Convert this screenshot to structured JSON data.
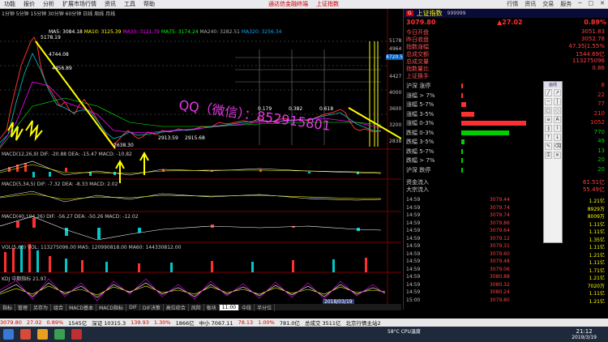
{
  "menubar": {
    "items": [
      "功能",
      "报价",
      "分析",
      "扩展市场行情",
      "资讯",
      "工具",
      "帮助"
    ],
    "center_links": [
      "通达信金融终端",
      "上证指数"
    ],
    "window_buttons": [
      "行情",
      "资讯",
      "交易",
      "服务"
    ]
  },
  "chart": {
    "period_tabs": [
      "1分钟",
      "5分钟",
      "15分钟",
      "30分钟",
      "60分钟",
      "日线",
      "周线",
      "月线"
    ],
    "ma_legend": [
      {
        "label": "MA5: 3084.18",
        "color": "#ffffff"
      },
      {
        "label": "MA10: 3125.39",
        "color": "#ffff00"
      },
      {
        "label": "MA30: 3121.79",
        "color": "#ff00ff"
      },
      {
        "label": "MA75: 3174.24",
        "color": "#00ff00"
      },
      {
        "label": "MA240: 3282.51",
        "color": "#888888"
      },
      {
        "label": "MA320: 3256.34",
        "color": "#00aaff"
      }
    ],
    "price_labels": [
      "5178",
      "4964",
      "4720.5",
      "4427",
      "4000",
      "3600",
      "3200",
      "2838"
    ],
    "left_annotations": [
      "5178.19",
      "4744.08",
      "4456.89",
      "2638.30",
      "2913.59",
      "2915.68"
    ],
    "fib_labels": [
      "0.179",
      "0.382",
      "0.618"
    ],
    "watermark": "QQ（微信）：852915801",
    "sub_panels": [
      {
        "label": "MACD(12,26,9)  DIF: -20.88  DEA: -15.47  MACD: -10.82"
      },
      {
        "label": "MACD(5,34,5)  DIF: -7.32  DEA: -8.33  MACD: 2.02"
      },
      {
        "label": "MACD(40,104,26)  DIF: -56.27  DEA: -50.26  MACD: -12.02"
      },
      {
        "label": "VOL(5,60)  VOL: 113275096.00  MA5: 120990818.00  MA60: 144330812.00"
      },
      {
        "label": "KDJ  中期指标  21.97"
      }
    ],
    "date_marker": "2018/03/19",
    "time_label": "11:00"
  },
  "tabs": [
    "指标",
    "管理",
    "另存为",
    "组合",
    "MACD基本",
    "MACD指标",
    "DIF",
    "DIF决策",
    "高位综合",
    "风险",
    "板块",
    "11:00",
    "中段",
    "半分位"
  ],
  "index_panel": {
    "badge": "G",
    "name": "上证指数",
    "code": "999999",
    "price": "3079.80",
    "change": "▲27.02",
    "pct": "0.89%",
    "rows": [
      {
        "label": "今日开盘",
        "value": "3051.83"
      },
      {
        "label": "昨日收盘",
        "value": "3052.78"
      },
      {
        "label": "指数涨幅",
        "value": "47.35|1.55%"
      },
      {
        "label": "总成交额",
        "value": "1544.69亿"
      },
      {
        "label": "总成交量",
        "value": "113275096"
      },
      {
        "label": "指数量比",
        "value": "0.86"
      },
      {
        "label": "上证换手",
        "value": ""
      }
    ],
    "breadth": [
      {
        "label": "沪深 涨停",
        "value": "8",
        "color": "#ff3030"
      },
      {
        "label": "涨幅 > 7%",
        "value": "22",
        "color": "#ff3030"
      },
      {
        "label": "涨幅 5-7%",
        "value": "77",
        "color": "#ff3030"
      },
      {
        "label": "涨幅 3-5%",
        "value": "210",
        "color": "#ff3030"
      },
      {
        "label": "涨幅 0-3%",
        "value": "1052",
        "color": "#ff3030"
      },
      {
        "label": "跌幅 0-3%",
        "value": "770",
        "color": "#00d000"
      },
      {
        "label": "跌幅 3-5%",
        "value": "49",
        "color": "#00d000"
      },
      {
        "label": "跌幅 5-7%",
        "value": "13",
        "color": "#00d000"
      },
      {
        "label": "跌幅 > 7%",
        "value": "20",
        "color": "#00d000"
      },
      {
        "label": "沪深 跌停",
        "value": "20",
        "color": "#00d000"
      }
    ],
    "money_in": "61.51亿",
    "money_out": "55.49亿",
    "big_in_label": "大宗流入",
    "ticks": [
      {
        "time": "14:59",
        "price": "3079.44",
        "vol": "1.21亿"
      },
      {
        "time": "14:59",
        "price": "3079.74",
        "vol": "8929万"
      },
      {
        "time": "14:59",
        "price": "3079.74",
        "vol": "8009万"
      },
      {
        "time": "14:59",
        "price": "3079.86",
        "vol": "1.11亿"
      },
      {
        "time": "14:59",
        "price": "3079.64",
        "vol": "1.11亿"
      },
      {
        "time": "14:59",
        "price": "3079.12",
        "vol": "1.35亿"
      },
      {
        "time": "14:59",
        "price": "3079.31",
        "vol": "1.11亿"
      },
      {
        "time": "14:59",
        "price": "3079.60",
        "vol": "1.21亿"
      },
      {
        "time": "14:59",
        "price": "3079.48",
        "vol": "1.11亿"
      },
      {
        "time": "14:59",
        "price": "3079.06",
        "vol": "1.71亿"
      },
      {
        "time": "14:59",
        "price": "3080.88",
        "vol": "1.21亿"
      },
      {
        "time": "14:59",
        "price": "3080.32",
        "vol": "7020万"
      },
      {
        "time": "14:59",
        "price": "3080.24",
        "vol": "1.11亿"
      },
      {
        "time": "15:00",
        "price": "3079.80",
        "vol": "1.21亿"
      }
    ]
  },
  "statusbar": {
    "items": [
      "3079.80",
      "27.02",
      "0.89%",
      "1545亿",
      "深证 10315.3",
      "139.93",
      "1.30%",
      "1866亿",
      "中小 7067.11",
      "78.13",
      "1.00%",
      "781.0亿",
      "总成交 3511亿",
      "北京行情主站2"
    ]
  },
  "taskbar": {
    "weather": "58°C  CPU温度",
    "time": "21:12",
    "date": "2019/3/19"
  }
}
